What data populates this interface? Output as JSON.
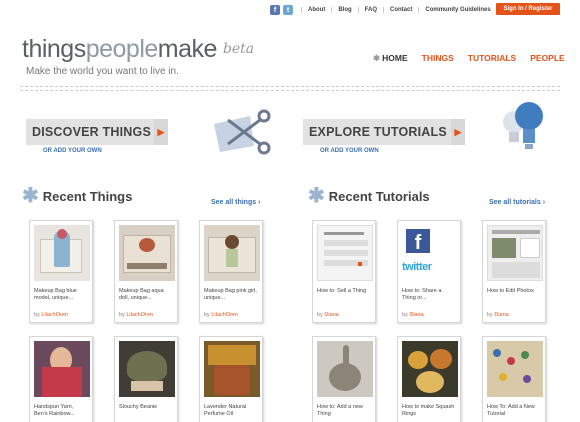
{
  "topbar": {
    "social": [
      "f",
      "t"
    ],
    "links": [
      "About",
      "Blog",
      "FAQ",
      "Contact",
      "Community Guidelines"
    ],
    "signin": "Sign In / Register"
  },
  "logo": {
    "part1": "things",
    "part2": "people",
    "part3": "make",
    "beta": "beta"
  },
  "tagline": "Make the world you want to live in.",
  "mainnav": {
    "home": "HOME",
    "things": "THINGS",
    "tutorials": "TUTORIALS",
    "people": "PEOPLE"
  },
  "promo": {
    "discover": "DISCOVER THINGS",
    "discover_sub": "OR ADD YOUR OWN",
    "explore": "EXPLORE TUTORIALS",
    "explore_sub": "OR ADD YOUR OWN"
  },
  "recent_things": {
    "title": "Recent Things",
    "see_all": "See all things",
    "cards": [
      {
        "title": "Makeup Bag blue model, unique...",
        "by": "by",
        "author": "LilachOren"
      },
      {
        "title": "Makeup Bag aqua doll, unique...",
        "by": "by",
        "author": "LilachOren"
      },
      {
        "title": "Makeup Bag pink girl, unique...",
        "by": "by",
        "author": "LilachOren"
      },
      {
        "title": "Handspun Yarn, Ben's Rainbow...",
        "by": "",
        "author": ""
      },
      {
        "title": "Slouchy Beanie",
        "by": "",
        "author": ""
      },
      {
        "title": "Lavender Natural Perfume Oil",
        "by": "",
        "author": ""
      }
    ]
  },
  "recent_tutorials": {
    "title": "Recent Tutorials",
    "see_all": "See all tutorials",
    "cards": [
      {
        "title": "How to: Sell a Thing",
        "by": "by",
        "author": "Diana"
      },
      {
        "title": "How to: Share a Thing or...",
        "by": "by",
        "author": "Diana"
      },
      {
        "title": "How to Edit Photos",
        "by": "by",
        "author": "Diana"
      },
      {
        "title": "How to: Add a new Thing",
        "by": "",
        "author": ""
      },
      {
        "title": "How to make Squash Rings",
        "by": "",
        "author": ""
      },
      {
        "title": "How To: Add a New Tutorial",
        "by": "",
        "author": ""
      }
    ]
  },
  "colors": {
    "accent": "#e4541a",
    "link": "#3a6fb0",
    "logo_light": "#8d9aa8"
  },
  "icons": [
    "facebook-icon",
    "twitter-icon",
    "scissors-icon",
    "lightbulb-icon",
    "chevron-right-icon",
    "asterisk-icon"
  ]
}
